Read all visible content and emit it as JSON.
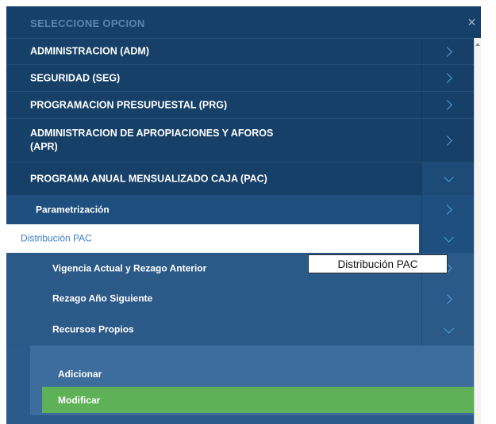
{
  "header": {
    "title": "SELECCIONE OPCION",
    "close": "×"
  },
  "menu": {
    "adm": "ADMINISTRACION (ADM)",
    "seg": "SEGURIDAD (SEG)",
    "prg": "PROGRAMACION PRESUPUESTAL (PRG)",
    "apr_line1": "ADMINISTRACION DE APROPIACIONES Y AFOROS",
    "apr_line2": "(APR)",
    "pac": "PROGRAMA ANUAL MENSUALIZADO CAJA (PAC)",
    "parametrizacion": "Parametrización",
    "distribucion": "Distribución PAC",
    "vigencia": "Vigencia Actual y Rezago Anterior",
    "rezago": "Rezago Año Siguiente",
    "recursos": "Recursos Propios",
    "adicionar": "Adicionar",
    "modificar": "Modificar"
  },
  "tooltip": {
    "text": "Distribución PAC"
  },
  "colors": {
    "active_item": "#5fb157",
    "header": "#174068",
    "link": "#3d7fc4"
  }
}
